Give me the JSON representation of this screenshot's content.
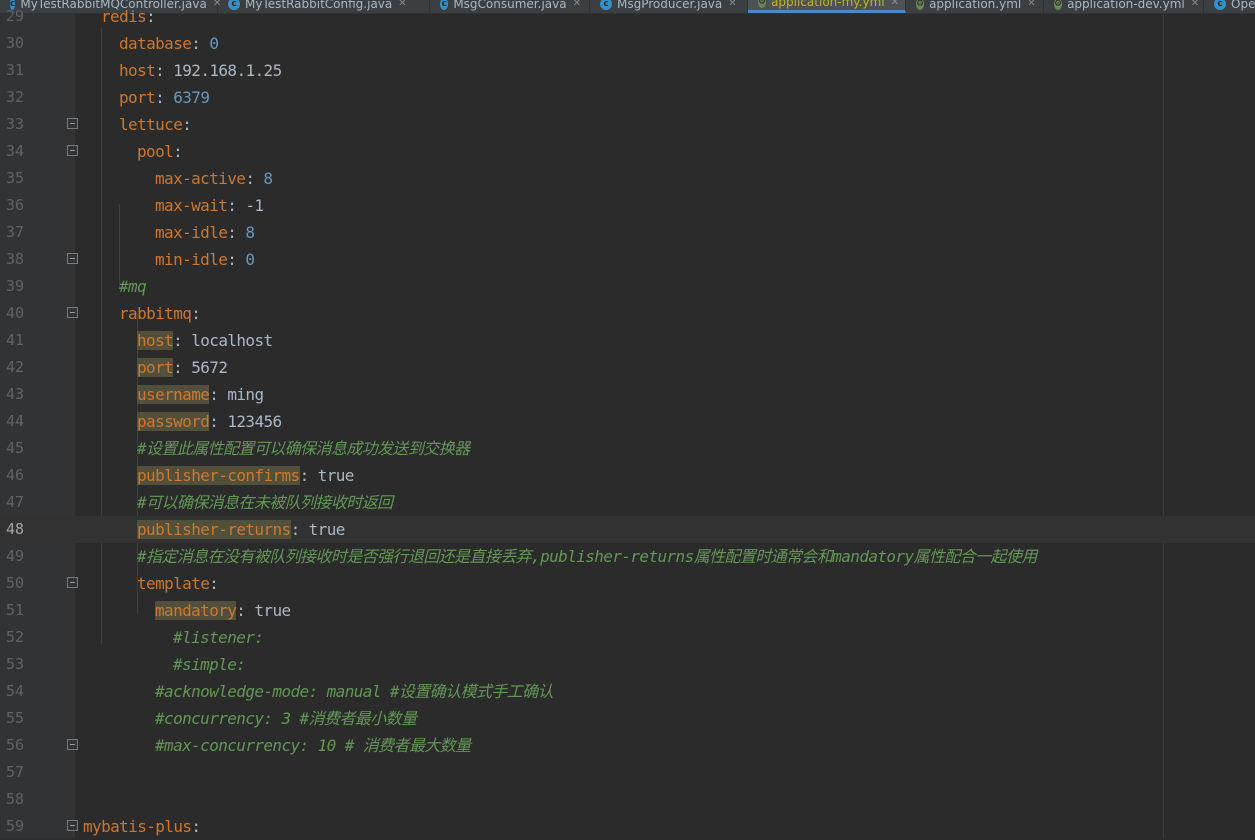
{
  "tabs": [
    {
      "label": "MyTestRabbitMQController.java",
      "icon": "class-icon",
      "active": false
    },
    {
      "label": "MyTestRabbitConfig.java",
      "icon": "class-icon",
      "active": false
    },
    {
      "label": "MsgConsumer.java",
      "icon": "class-icon",
      "active": false
    },
    {
      "label": "MsgProducer.java",
      "icon": "class-icon",
      "active": false
    },
    {
      "label": "application-my.yml",
      "icon": "yml-icon",
      "active": true
    },
    {
      "label": "application.yml",
      "icon": "yml-icon",
      "active": false
    },
    {
      "label": "application-dev.yml",
      "icon": "yml-icon",
      "active": false
    },
    {
      "label": "Ope",
      "icon": "class-icon",
      "active": false
    }
  ],
  "editor": {
    "current_line": "48",
    "lines": [
      {
        "num": "29",
        "key": "redis",
        "sep": ":"
      },
      {
        "num": "30",
        "key": "database",
        "sep": ": ",
        "num_val": "0"
      },
      {
        "num": "31",
        "key": "host",
        "sep": ": ",
        "str_val": "192.168.1.25"
      },
      {
        "num": "32",
        "key": "port",
        "sep": ": ",
        "num_val": "6379"
      },
      {
        "num": "33",
        "key": "lettuce",
        "sep": ":"
      },
      {
        "num": "34",
        "key": "pool",
        "sep": ":"
      },
      {
        "num": "35",
        "key": "max-active",
        "sep": ": ",
        "num_val": "8"
      },
      {
        "num": "36",
        "key": "max-wait",
        "sep": ": ",
        "str_val": "-1"
      },
      {
        "num": "37",
        "key": "max-idle",
        "sep": ": ",
        "num_val": "8"
      },
      {
        "num": "38",
        "key": "min-idle",
        "sep": ": ",
        "num_val": "0"
      },
      {
        "num": "39",
        "comment": "#mq"
      },
      {
        "num": "40",
        "key": "rabbitmq",
        "sep": ":"
      },
      {
        "num": "41",
        "key": "host",
        "sep": ": ",
        "str_val": "localhost"
      },
      {
        "num": "42",
        "key": "port",
        "sep": ": ",
        "str_val": "5672"
      },
      {
        "num": "43",
        "key": "username",
        "sep": ": ",
        "str_val": "ming"
      },
      {
        "num": "44",
        "key": "password",
        "sep": ": ",
        "str_val": "123456"
      },
      {
        "num": "45",
        "comment": "#设置此属性配置可以确保消息成功发送到交换器"
      },
      {
        "num": "46",
        "key": "publisher-confirms",
        "sep": ": ",
        "str_val": "true"
      },
      {
        "num": "47",
        "comment": "#可以确保消息在未被队列接收时返回"
      },
      {
        "num": "48",
        "key": "publisher-returns",
        "sep": ": ",
        "str_val": "true"
      },
      {
        "num": "49",
        "comment": "#指定消息在没有被队列接收时是否强行退回还是直接丢弃,publisher-returns属性配置时通常会和mandatory属性配合一起使用"
      },
      {
        "num": "50",
        "key": "template",
        "sep": ":"
      },
      {
        "num": "51",
        "key": "mandatory",
        "sep": ": ",
        "str_val": "true"
      },
      {
        "num": "52",
        "comment": "#listener:"
      },
      {
        "num": "53",
        "comment": "#simple:"
      },
      {
        "num": "54",
        "comment": "#acknowledge-mode: manual #设置确认模式手工确认"
      },
      {
        "num": "55",
        "comment": "#concurrency: 3 #消费者最小数量"
      },
      {
        "num": "56",
        "comment": "#max-concurrency: 10 # 消费者最大数量"
      },
      {
        "num": "57"
      },
      {
        "num": "58"
      },
      {
        "num": "59",
        "key": "mybatis-plus",
        "sep": ":"
      }
    ]
  }
}
